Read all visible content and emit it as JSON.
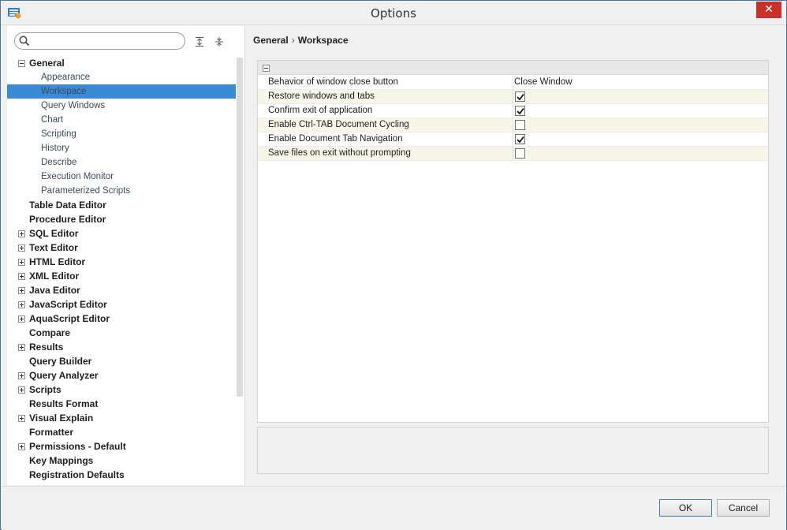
{
  "window": {
    "title": "Options",
    "close_glyph": "✕"
  },
  "search": {
    "value": "",
    "placeholder": ""
  },
  "icons": {
    "app": "app-icon",
    "search": "search-icon",
    "expand_all": "expand-all-icon",
    "collapse_all": "collapse-all-icon",
    "close": "close-icon"
  },
  "tree": [
    {
      "label": "General",
      "level": "top",
      "expander": "minus"
    },
    {
      "label": "Appearance",
      "level": "child"
    },
    {
      "label": "Workspace",
      "level": "child",
      "selected": true
    },
    {
      "label": "Query Windows",
      "level": "child"
    },
    {
      "label": "Chart",
      "level": "child"
    },
    {
      "label": "Scripting",
      "level": "child"
    },
    {
      "label": "History",
      "level": "child"
    },
    {
      "label": "Describe",
      "level": "child"
    },
    {
      "label": "Execution Monitor",
      "level": "child"
    },
    {
      "label": "Parameterized Scripts",
      "level": "child"
    },
    {
      "label": "Table Data Editor",
      "level": "top"
    },
    {
      "label": "Procedure Editor",
      "level": "top"
    },
    {
      "label": "SQL Editor",
      "level": "top",
      "expander": "plus"
    },
    {
      "label": "Text Editor",
      "level": "top",
      "expander": "plus"
    },
    {
      "label": "HTML Editor",
      "level": "top",
      "expander": "plus"
    },
    {
      "label": "XML Editor",
      "level": "top",
      "expander": "plus"
    },
    {
      "label": "Java Editor",
      "level": "top",
      "expander": "plus"
    },
    {
      "label": "JavaScript Editor",
      "level": "top",
      "expander": "plus"
    },
    {
      "label": "AquaScript Editor",
      "level": "top",
      "expander": "plus"
    },
    {
      "label": "Compare",
      "level": "top"
    },
    {
      "label": "Results",
      "level": "top",
      "expander": "plus"
    },
    {
      "label": "Query Builder",
      "level": "top"
    },
    {
      "label": "Query Analyzer",
      "level": "top",
      "expander": "plus"
    },
    {
      "label": "Scripts",
      "level": "top",
      "expander": "plus"
    },
    {
      "label": "Results Format",
      "level": "top"
    },
    {
      "label": "Visual Explain",
      "level": "top",
      "expander": "plus"
    },
    {
      "label": "Formatter",
      "level": "top"
    },
    {
      "label": "Permissions - Default",
      "level": "top",
      "expander": "plus"
    },
    {
      "label": "Key Mappings",
      "level": "top"
    },
    {
      "label": "Registration Defaults",
      "level": "top"
    }
  ],
  "breadcrumb": {
    "root": "General",
    "separator": "›",
    "current": "Workspace"
  },
  "properties": [
    {
      "name": "Behavior of window close button",
      "type": "text",
      "value": "Close Window"
    },
    {
      "name": "Restore windows and tabs",
      "type": "checkbox",
      "checked": true
    },
    {
      "name": "Confirm exit of application",
      "type": "checkbox",
      "checked": true
    },
    {
      "name": "Enable Ctrl-TAB Document Cycling",
      "type": "checkbox",
      "checked": false
    },
    {
      "name": "Enable Document Tab Navigation",
      "type": "checkbox",
      "checked": true
    },
    {
      "name": "Save files on exit without prompting",
      "type": "checkbox",
      "checked": false
    }
  ],
  "buttons": {
    "ok": "OK",
    "cancel": "Cancel"
  },
  "colors": {
    "selection": "#3b8ad6",
    "close_button": "#c7302b",
    "window_border": "#4a74b8"
  }
}
